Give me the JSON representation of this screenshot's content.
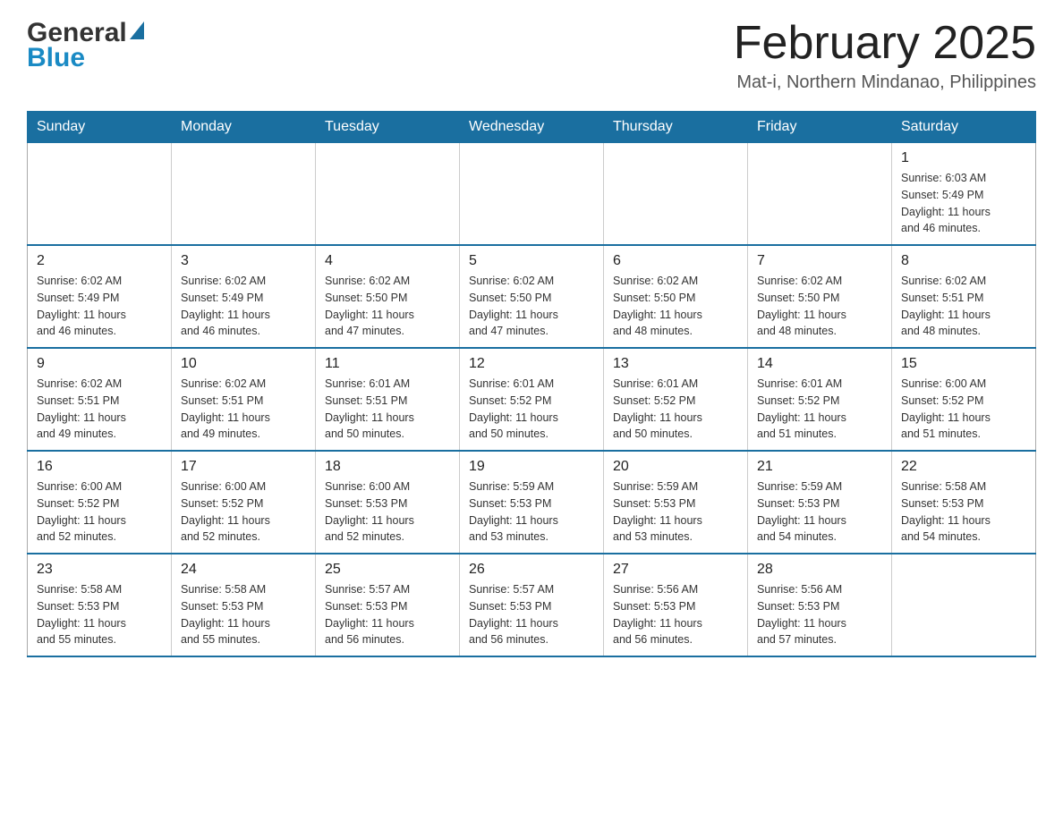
{
  "header": {
    "logo_general": "General",
    "logo_blue": "Blue",
    "month_title": "February 2025",
    "subtitle": "Mat-i, Northern Mindanao, Philippines"
  },
  "calendar": {
    "days_of_week": [
      "Sunday",
      "Monday",
      "Tuesday",
      "Wednesday",
      "Thursday",
      "Friday",
      "Saturday"
    ],
    "weeks": [
      [
        {
          "day": "",
          "info": ""
        },
        {
          "day": "",
          "info": ""
        },
        {
          "day": "",
          "info": ""
        },
        {
          "day": "",
          "info": ""
        },
        {
          "day": "",
          "info": ""
        },
        {
          "day": "",
          "info": ""
        },
        {
          "day": "1",
          "info": "Sunrise: 6:03 AM\nSunset: 5:49 PM\nDaylight: 11 hours\nand 46 minutes."
        }
      ],
      [
        {
          "day": "2",
          "info": "Sunrise: 6:02 AM\nSunset: 5:49 PM\nDaylight: 11 hours\nand 46 minutes."
        },
        {
          "day": "3",
          "info": "Sunrise: 6:02 AM\nSunset: 5:49 PM\nDaylight: 11 hours\nand 46 minutes."
        },
        {
          "day": "4",
          "info": "Sunrise: 6:02 AM\nSunset: 5:50 PM\nDaylight: 11 hours\nand 47 minutes."
        },
        {
          "day": "5",
          "info": "Sunrise: 6:02 AM\nSunset: 5:50 PM\nDaylight: 11 hours\nand 47 minutes."
        },
        {
          "day": "6",
          "info": "Sunrise: 6:02 AM\nSunset: 5:50 PM\nDaylight: 11 hours\nand 48 minutes."
        },
        {
          "day": "7",
          "info": "Sunrise: 6:02 AM\nSunset: 5:50 PM\nDaylight: 11 hours\nand 48 minutes."
        },
        {
          "day": "8",
          "info": "Sunrise: 6:02 AM\nSunset: 5:51 PM\nDaylight: 11 hours\nand 48 minutes."
        }
      ],
      [
        {
          "day": "9",
          "info": "Sunrise: 6:02 AM\nSunset: 5:51 PM\nDaylight: 11 hours\nand 49 minutes."
        },
        {
          "day": "10",
          "info": "Sunrise: 6:02 AM\nSunset: 5:51 PM\nDaylight: 11 hours\nand 49 minutes."
        },
        {
          "day": "11",
          "info": "Sunrise: 6:01 AM\nSunset: 5:51 PM\nDaylight: 11 hours\nand 50 minutes."
        },
        {
          "day": "12",
          "info": "Sunrise: 6:01 AM\nSunset: 5:52 PM\nDaylight: 11 hours\nand 50 minutes."
        },
        {
          "day": "13",
          "info": "Sunrise: 6:01 AM\nSunset: 5:52 PM\nDaylight: 11 hours\nand 50 minutes."
        },
        {
          "day": "14",
          "info": "Sunrise: 6:01 AM\nSunset: 5:52 PM\nDaylight: 11 hours\nand 51 minutes."
        },
        {
          "day": "15",
          "info": "Sunrise: 6:00 AM\nSunset: 5:52 PM\nDaylight: 11 hours\nand 51 minutes."
        }
      ],
      [
        {
          "day": "16",
          "info": "Sunrise: 6:00 AM\nSunset: 5:52 PM\nDaylight: 11 hours\nand 52 minutes."
        },
        {
          "day": "17",
          "info": "Sunrise: 6:00 AM\nSunset: 5:52 PM\nDaylight: 11 hours\nand 52 minutes."
        },
        {
          "day": "18",
          "info": "Sunrise: 6:00 AM\nSunset: 5:53 PM\nDaylight: 11 hours\nand 52 minutes."
        },
        {
          "day": "19",
          "info": "Sunrise: 5:59 AM\nSunset: 5:53 PM\nDaylight: 11 hours\nand 53 minutes."
        },
        {
          "day": "20",
          "info": "Sunrise: 5:59 AM\nSunset: 5:53 PM\nDaylight: 11 hours\nand 53 minutes."
        },
        {
          "day": "21",
          "info": "Sunrise: 5:59 AM\nSunset: 5:53 PM\nDaylight: 11 hours\nand 54 minutes."
        },
        {
          "day": "22",
          "info": "Sunrise: 5:58 AM\nSunset: 5:53 PM\nDaylight: 11 hours\nand 54 minutes."
        }
      ],
      [
        {
          "day": "23",
          "info": "Sunrise: 5:58 AM\nSunset: 5:53 PM\nDaylight: 11 hours\nand 55 minutes."
        },
        {
          "day": "24",
          "info": "Sunrise: 5:58 AM\nSunset: 5:53 PM\nDaylight: 11 hours\nand 55 minutes."
        },
        {
          "day": "25",
          "info": "Sunrise: 5:57 AM\nSunset: 5:53 PM\nDaylight: 11 hours\nand 56 minutes."
        },
        {
          "day": "26",
          "info": "Sunrise: 5:57 AM\nSunset: 5:53 PM\nDaylight: 11 hours\nand 56 minutes."
        },
        {
          "day": "27",
          "info": "Sunrise: 5:56 AM\nSunset: 5:53 PM\nDaylight: 11 hours\nand 56 minutes."
        },
        {
          "day": "28",
          "info": "Sunrise: 5:56 AM\nSunset: 5:53 PM\nDaylight: 11 hours\nand 57 minutes."
        },
        {
          "day": "",
          "info": ""
        }
      ]
    ]
  }
}
